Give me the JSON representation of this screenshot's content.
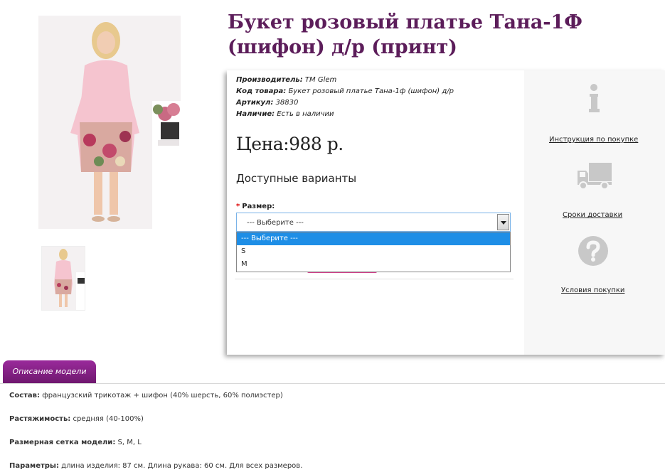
{
  "product": {
    "title": "Букет розовый платье Тана-1Ф (шифон) д/р (принт)",
    "meta": {
      "manufacturer_label": "Производитель:",
      "manufacturer_value": "TM Glem",
      "code_label": "Код товара:",
      "code_value": "Букет розовый платье Тана-1ф (шифон) д/р",
      "article_label": "Артикул:",
      "article_value": "38830",
      "stock_label": "Наличие:",
      "stock_value": "Есть в наличии"
    },
    "price": "Цена:988 р.",
    "variants_heading": "Доступные варианты",
    "size": {
      "required_mark": "*",
      "label": "Размер:",
      "selected": "--- Выберите ---",
      "options": [
        "--- Выберите ---",
        "S",
        "M"
      ]
    }
  },
  "sidebar": {
    "links": [
      "Инструкция по покупке",
      "Сроки доставки",
      "Условия покупки"
    ]
  },
  "tabs": {
    "active": "Описание модели"
  },
  "description": {
    "composition_label": "Состав:",
    "composition_value": " французский трикотаж + шифон (40% шерсть, 60% полиэстер)",
    "stretch_label": "Растяжимость:",
    "stretch_value": " средняя (40-100%)",
    "sizes_label": "Размерная сетка модели:",
    "sizes_value": " S, M, L",
    "params_label": "Параметры:",
    "params_value": " длина изделия: 87 см. Длина рукава: 60 см. Для всех размеров."
  },
  "colors": {
    "title": "#5c1d5a",
    "tab": "#8a238b",
    "select_highlight": "#1e8ee6",
    "icon_gray": "#c8c8c8"
  }
}
